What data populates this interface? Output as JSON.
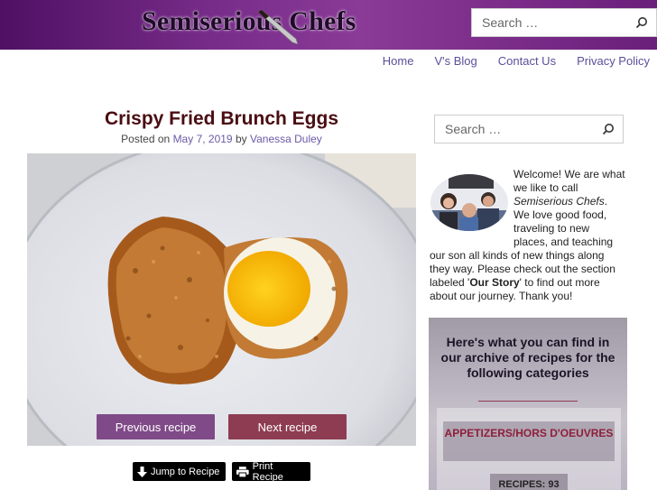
{
  "header": {
    "logo_text": "Semiserious Chefs",
    "search_placeholder": "Search …"
  },
  "nav": {
    "items": [
      {
        "label": "Home"
      },
      {
        "label": "V's Blog"
      },
      {
        "label": "Contact Us"
      },
      {
        "label": "Privacy Policy"
      }
    ]
  },
  "post": {
    "title": "Crispy Fried Brunch Eggs",
    "posted_on_label": "Posted on",
    "date": "May 7, 2019",
    "by_label": "by",
    "author": "Vanessa Duley",
    "prev_label": "Previous recipe",
    "next_label": "Next recipe",
    "jump_label": "Jump to Recipe",
    "print_label": "Print Recipe"
  },
  "sidebar": {
    "search_placeholder": "Search …",
    "welcome_p1": "Welcome! We are what we like to call ",
    "welcome_brand": "Semiserious Chefs",
    "welcome_p2": ". We love good food, traveling to new places, and teaching our son all kinds of new things along they way. Please check out the section labeled '",
    "welcome_link": "Our Story",
    "welcome_p3": "' to find out more about our journey. Thank you!",
    "archive_heading": "Here's what you can find in our archive of recipes for the following categories",
    "category_label": "APPETIZERS/HORS D'OEUVRES",
    "category_count": "RECIPES: 93"
  },
  "colors": {
    "header_purple": "#6a1f7b",
    "title_maroon": "#4a0d12",
    "link_purple": "#6a5aa8",
    "prev_button": "#7f4a87",
    "next_button": "#8e3c52"
  }
}
